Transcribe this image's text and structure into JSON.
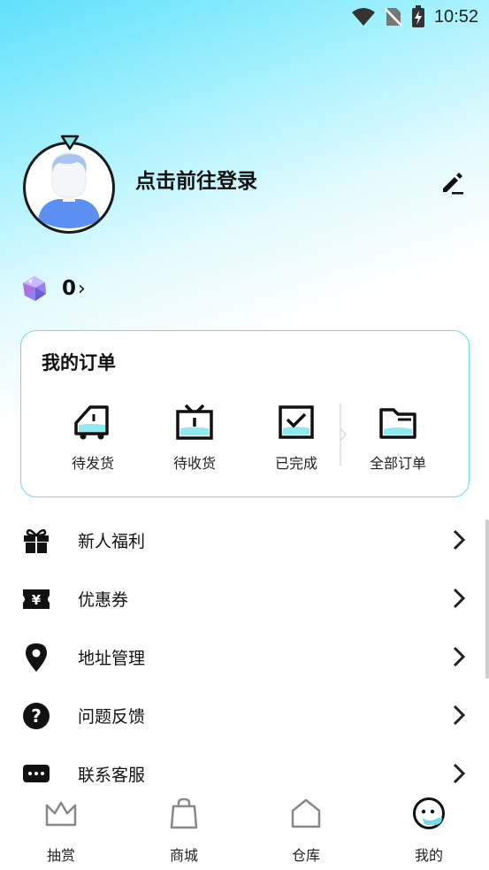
{
  "status_bar": {
    "time": "10:52"
  },
  "profile": {
    "login_prompt": "点击前往登录"
  },
  "points": {
    "value": "0",
    "chevron": "›"
  },
  "orders": {
    "title": "我的订单",
    "items": [
      {
        "label": "待发货",
        "icon": "truck-icon"
      },
      {
        "label": "待收货",
        "icon": "tv-box-icon"
      },
      {
        "label": "已完成",
        "icon": "checkbox-icon"
      },
      {
        "label": "全部订单",
        "icon": "folder-icon"
      }
    ]
  },
  "menu": [
    {
      "label": "新人福利",
      "icon": "gift-icon"
    },
    {
      "label": "优惠券",
      "icon": "coupon-icon"
    },
    {
      "label": "地址管理",
      "icon": "location-pin-icon"
    },
    {
      "label": "问题反馈",
      "icon": "question-icon"
    },
    {
      "label": "联系客服",
      "icon": "chat-icon"
    }
  ],
  "bottom_nav": [
    {
      "label": "抽赏",
      "icon": "crown-icon",
      "active": false
    },
    {
      "label": "商城",
      "icon": "shopping-bag-icon",
      "active": false
    },
    {
      "label": "仓库",
      "icon": "home-icon",
      "active": false
    },
    {
      "label": "我的",
      "icon": "profile-face-icon",
      "active": true
    }
  ],
  "colors": {
    "accent": "#5fe0fb",
    "card_border": "#63dcf2",
    "text": "#111111"
  }
}
